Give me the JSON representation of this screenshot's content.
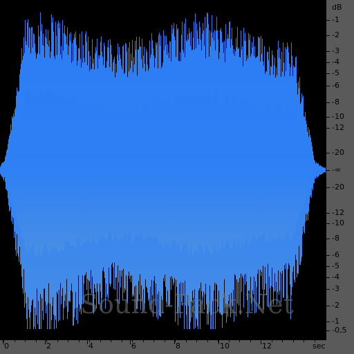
{
  "db_scale": {
    "unit": "dB",
    "labels": [
      "-1",
      "-2",
      "-3",
      "-4",
      "-5",
      "-6",
      "-8",
      "-10",
      "-12",
      "-20",
      "-∞",
      "-20",
      "-12",
      "-10",
      "-8",
      "-6",
      "-5",
      "-4",
      "-3",
      "-2",
      "-1",
      "-0,5"
    ]
  },
  "time_scale": {
    "labels": [
      "0",
      "2",
      "4",
      "6",
      "8",
      "10",
      "12"
    ],
    "unit": "sec"
  },
  "watermark": "Sound-Pack.Net",
  "colors": {
    "waveform_top": "#2f7ff2",
    "waveform_bottom": "#4a8ee6",
    "background": "#000000",
    "ruler": "#5a5a5a"
  }
}
